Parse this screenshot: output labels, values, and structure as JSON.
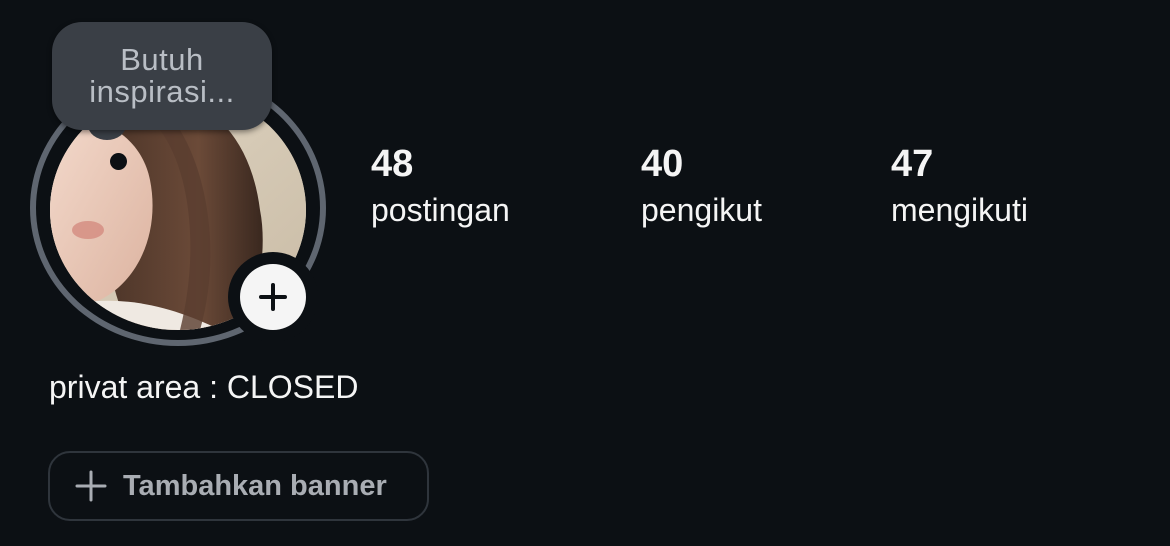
{
  "profile": {
    "note_text": "Butuh inspirasi...",
    "bio": "privat area : CLOSED"
  },
  "stats": [
    {
      "value": "48",
      "label": "postingan"
    },
    {
      "value": "40",
      "label": "pengikut"
    },
    {
      "value": "47",
      "label": "mengikuti"
    }
  ],
  "banner_button": {
    "label": "Tambahkan banner",
    "icon": "plus-icon"
  },
  "avatar": {
    "icon": "profile-photo",
    "add_story_icon": "plus-icon"
  },
  "colors": {
    "background": "#0c1014",
    "text": "#f5f5f5",
    "muted_text": "#a9adb3",
    "ring": "#5f6670",
    "note_bubble": "#3a3f46"
  }
}
